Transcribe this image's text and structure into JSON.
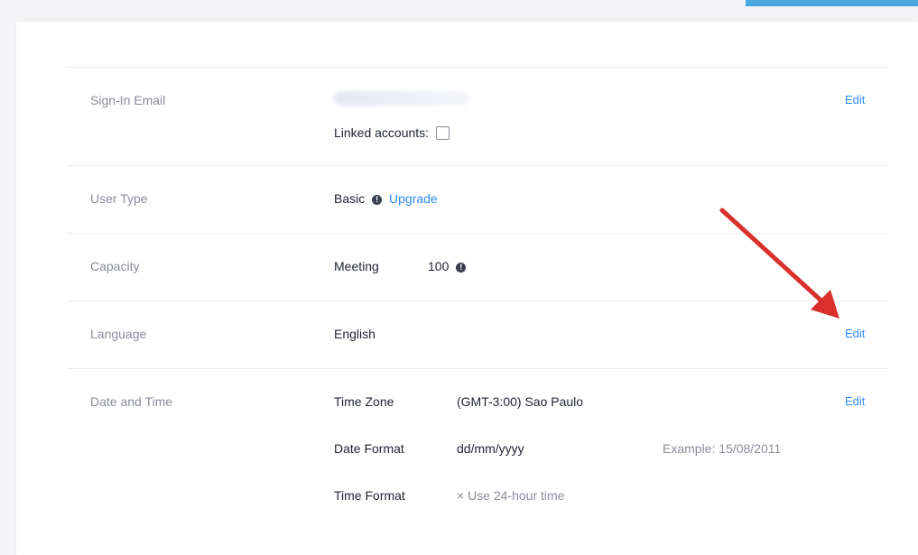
{
  "rows": {
    "email": {
      "label": "Sign-In Email",
      "linked_accounts": "Linked accounts:",
      "edit": "Edit"
    },
    "user_type": {
      "label": "User Type",
      "value": "Basic",
      "upgrade": "Upgrade"
    },
    "capacity": {
      "label": "Capacity",
      "meeting_label": "Meeting",
      "meeting_value": "100"
    },
    "language": {
      "label": "Language",
      "value": "English",
      "edit": "Edit"
    },
    "date_time": {
      "label": "Date and Time",
      "edit": "Edit",
      "time_zone_label": "Time Zone",
      "time_zone_value": "(GMT-3:00) Sao Paulo",
      "date_format_label": "Date Format",
      "date_format_value": "dd/mm/yyyy",
      "date_format_example": "Example: 15/08/2011",
      "time_format_label": "Time Format",
      "time_format_value": "× Use 24-hour time"
    }
  },
  "icons": {
    "info": "info-circle-icon",
    "linked": "linked-account-icon",
    "annotation": "red-arrow"
  },
  "colors": {
    "link": "#2d8cff",
    "arrow": "#d9302c",
    "accent": "#4aa9e0"
  }
}
